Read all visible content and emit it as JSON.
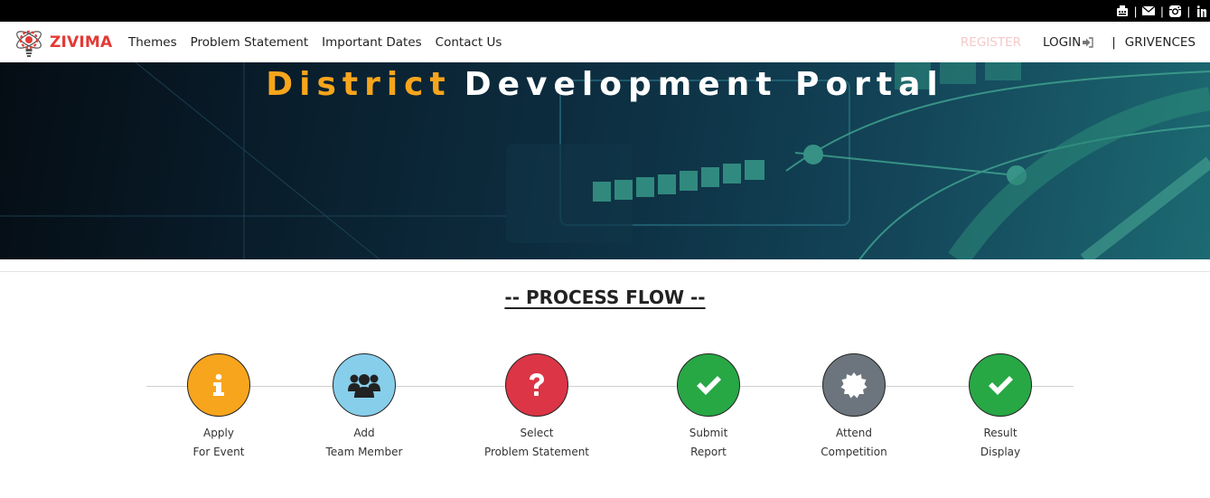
{
  "topbar": {
    "icons": [
      "fax-icon",
      "envelope-icon",
      "instagram-icon",
      "linkedin-icon"
    ],
    "separator": "|"
  },
  "brand": {
    "name": "ZIVIMA",
    "color": "#e53935"
  },
  "nav": {
    "items": [
      {
        "label": "Themes"
      },
      {
        "label": "Problem Statement"
      },
      {
        "label": "Important Dates"
      },
      {
        "label": "Contact Us"
      }
    ],
    "register": "REGISTER",
    "login": "LOGIN",
    "separator": "|",
    "grievances": "GRIVENCES"
  },
  "hero": {
    "title_part1": "District",
    "title_part2": "Development Portal",
    "accent_color": "#f7a51c"
  },
  "process_flow": {
    "title": "-- PROCESS FLOW --",
    "steps": [
      {
        "line1": "Apply",
        "line2": "For Event",
        "color": "#f7a51c",
        "icon": "info-icon"
      },
      {
        "line1": "Add",
        "line2": "Team Member",
        "color": "#87ceeb",
        "icon": "users-icon"
      },
      {
        "line1": "Select",
        "line2": "Problem Statement",
        "color": "#dc3545",
        "icon": "question-icon"
      },
      {
        "line1": "Submit",
        "line2": "Report",
        "color": "#28a745",
        "icon": "check-icon"
      },
      {
        "line1": "Attend",
        "line2": "Competition",
        "color": "#6c757d",
        "icon": "certificate-icon"
      },
      {
        "line1": "Result",
        "line2": "Display",
        "color": "#28a745",
        "icon": "check-icon"
      }
    ]
  }
}
